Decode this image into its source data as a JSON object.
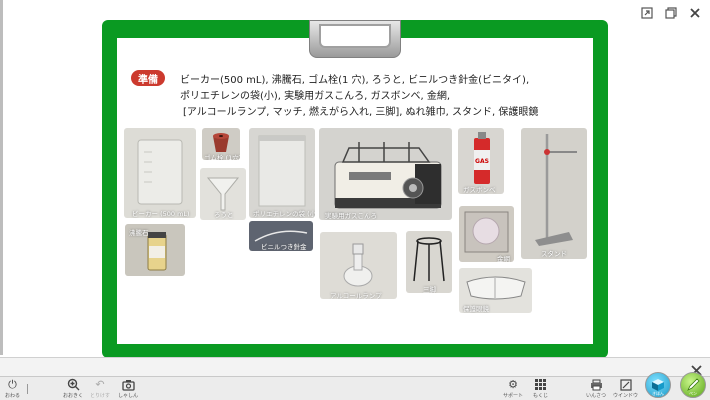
{
  "heading": {
    "badge": "準備",
    "lines": [
      "ビーカー(500 mL), 沸騰石, ゴム栓(1 穴), ろうと, ビニルつき針金(ビニタイ),",
      "ポリエチレンの袋(小), 実験用ガスこんろ, ガスボンベ, 金網,",
      "[アルコールランプ, マッチ, 燃えがら入れ, 三脚], ぬれ雑巾, スタンド, 保護眼鏡"
    ]
  },
  "items": [
    {
      "label": "ビーカー (500 mL)"
    },
    {
      "label": "ゴム栓 (1穴)"
    },
    {
      "label": "ろうと"
    },
    {
      "label": "沸騰石"
    },
    {
      "label": "ポリエチレンの袋 (小)"
    },
    {
      "label": "ビニルつき針金"
    },
    {
      "label": "実験用ガスこんろ"
    },
    {
      "label": "アルコールランプ"
    },
    {
      "label": "三脚"
    },
    {
      "label": "ガスボンベ"
    },
    {
      "label": "金網"
    },
    {
      "label": "保護眼鏡"
    },
    {
      "label": "スタンド"
    }
  ],
  "gas_can_text": "GAS",
  "toolbar": {
    "exit": "おわる",
    "zoom": "おおきく",
    "undo": "とりけす",
    "photo": "しゃしん",
    "support": "サポート",
    "grid": "もくじ",
    "print": "いんさつ",
    "window": "ウインドウ",
    "btn_left": "きほん",
    "btn_right": "ペン"
  },
  "colors": {
    "board": "#0a9a22",
    "badge": "#cc3a2e"
  }
}
